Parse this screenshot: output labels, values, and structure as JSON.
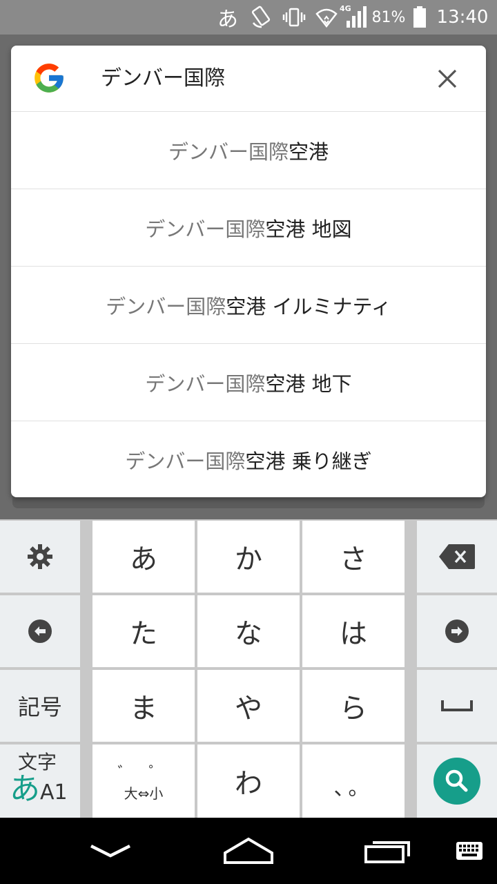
{
  "status_bar": {
    "ime": "あ",
    "network_type": "4G",
    "battery_percent": "81%",
    "time": "13:40",
    "icons": [
      "rotate-lock-icon",
      "vibrate-icon",
      "wifi-icon",
      "signal-icon",
      "battery-icon"
    ]
  },
  "search": {
    "query": "デンバー国際",
    "logo": "google-logo",
    "clear_icon": "close-icon"
  },
  "suggestions": [
    {
      "prefix": "デンバー国際",
      "rest": "空港"
    },
    {
      "prefix": "デンバー国際",
      "rest": "空港 地図"
    },
    {
      "prefix": "デンバー国際",
      "rest": "空港 イルミナティ"
    },
    {
      "prefix": "デンバー国際",
      "rest": "空港 地下"
    },
    {
      "prefix": "デンバー国際",
      "rest": "空港 乗り継ぎ"
    }
  ],
  "keyboard": {
    "kana_keys": [
      "あ",
      "か",
      "さ",
      "た",
      "な",
      "は",
      "ま",
      "や",
      "ら",
      "わ"
    ],
    "symbol_key": "記号",
    "mode_key": {
      "top": "文字",
      "kana": "あ",
      "latin": "A1"
    },
    "dakuten_key": {
      "top": "゛ ゜",
      "bottom": "大⇔小"
    },
    "punct_key": "、。",
    "accent_color": "#169e8a"
  },
  "nav_bar": {
    "icons": [
      "back-chevron-icon",
      "home-icon",
      "recents-icon",
      "keyboard-switch-icon"
    ]
  }
}
